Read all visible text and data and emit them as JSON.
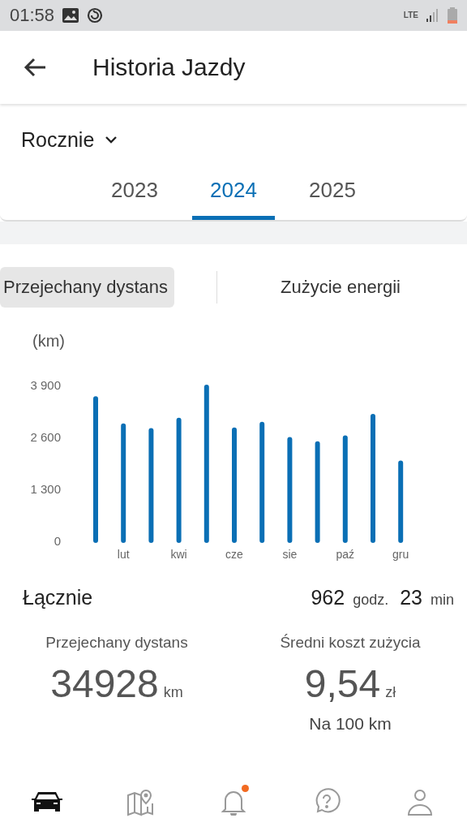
{
  "status_bar": {
    "time": "01:58",
    "network": "LTE"
  },
  "app_bar": {
    "title": "Historia Jazdy"
  },
  "period": {
    "value": "Rocznie"
  },
  "years": [
    {
      "label": "2023",
      "selected": false
    },
    {
      "label": "2024",
      "selected": true
    },
    {
      "label": "2025",
      "selected": false
    }
  ],
  "segments": [
    {
      "label": "Przejechany dystans",
      "selected": true
    },
    {
      "label": "Zużycie energii",
      "selected": false
    }
  ],
  "chart": {
    "unit": "(km)",
    "chart_data": {
      "type": "bar",
      "categories": [
        null,
        "lut",
        null,
        "kwi",
        null,
        "cze",
        null,
        "sie",
        null,
        "paź",
        null,
        "gru"
      ],
      "series": [
        {
          "color": "#0a6fb5",
          "values": [
            3550,
            2870,
            2750,
            3010,
            3840,
            2770,
            2910,
            2530,
            2420,
            2570,
            3110,
            1940
          ]
        }
      ],
      "ylim": [
        0,
        3900
      ],
      "yticks": [
        {
          "value": 0,
          "label": "0"
        },
        {
          "value": 1300,
          "label": "1 300"
        },
        {
          "value": 2600,
          "label": "2 600"
        },
        {
          "value": 3900,
          "label": "3 900"
        }
      ]
    }
  },
  "total": {
    "label": "Łącznie",
    "hours": "962",
    "hours_unit": "godz.",
    "minutes": "23",
    "minutes_unit": "min"
  },
  "stats": [
    {
      "label": "Przejechany dystans",
      "value": "34928",
      "unit": "km"
    },
    {
      "label": "Średni koszt zużycia",
      "value": "9,54",
      "unit": "zł",
      "note": "Na 100 km"
    }
  ],
  "nav": [
    {
      "kind": "car",
      "selected": true,
      "badge": false
    },
    {
      "kind": "map",
      "selected": false,
      "badge": false
    },
    {
      "kind": "bell",
      "selected": false,
      "badge": true
    },
    {
      "kind": "help",
      "selected": false,
      "badge": false
    },
    {
      "kind": "profile",
      "selected": false,
      "badge": false
    }
  ]
}
